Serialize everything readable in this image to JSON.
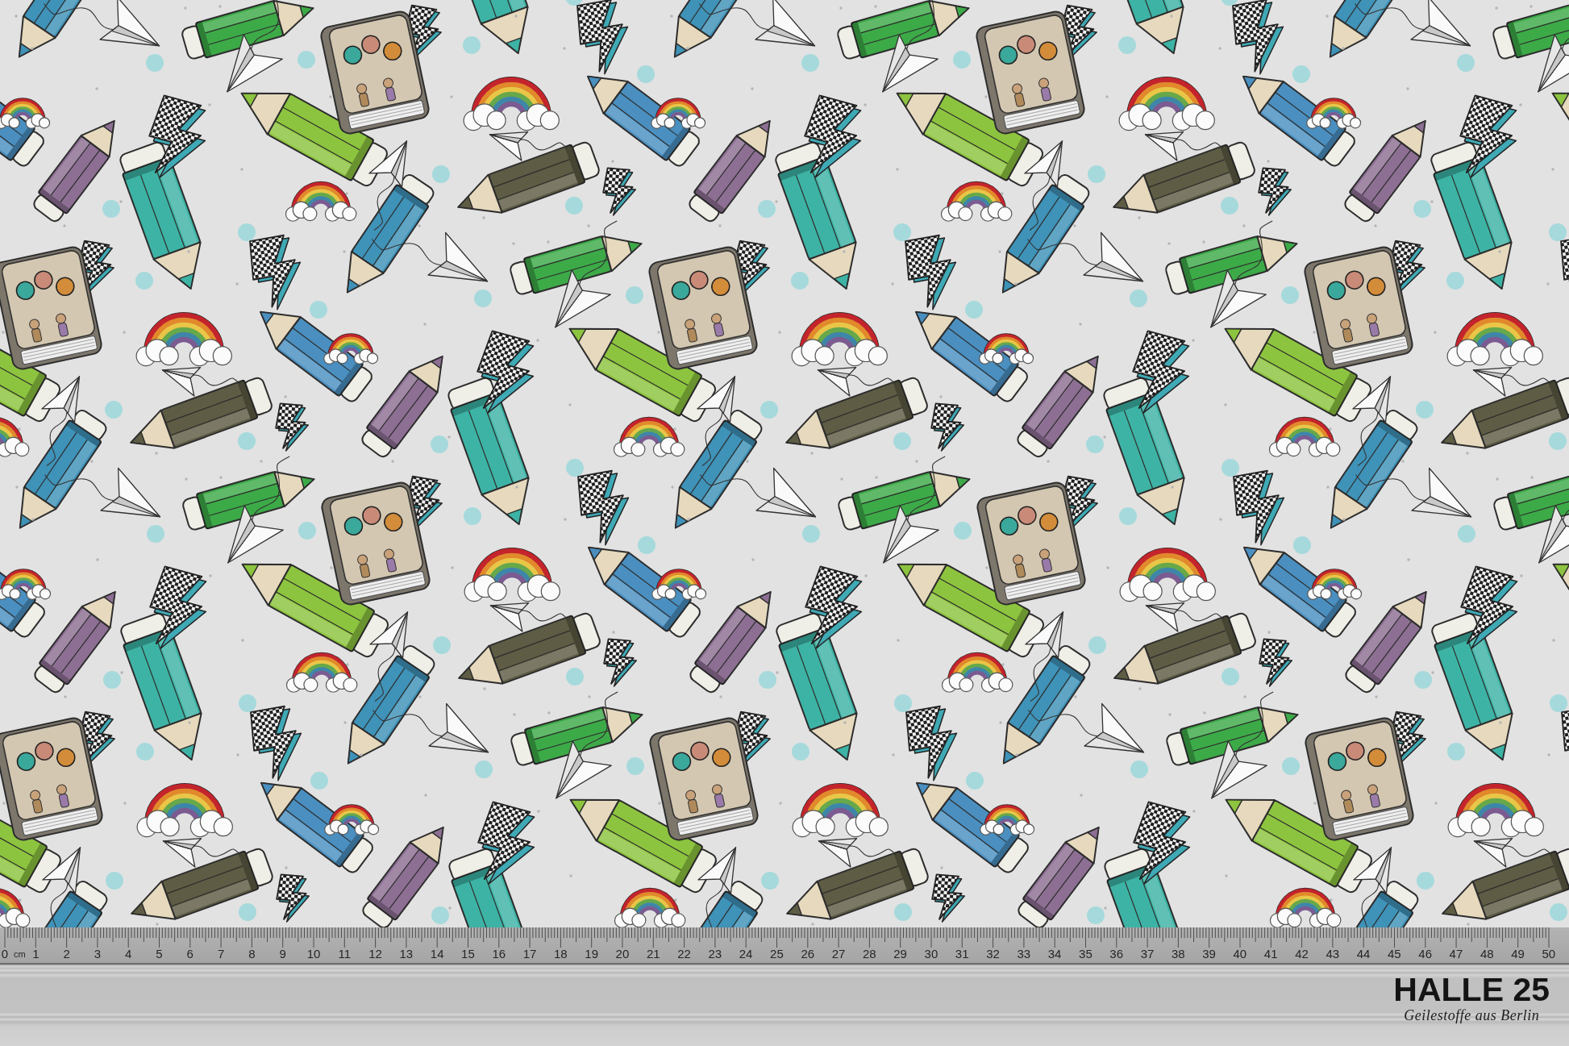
{
  "ruler": {
    "unit": "cm",
    "labels": [
      "0",
      "1",
      "2",
      "3",
      "4",
      "5",
      "6",
      "7",
      "8",
      "9",
      "10",
      "11",
      "12",
      "13",
      "14",
      "15",
      "16",
      "17",
      "18",
      "19",
      "20",
      "21",
      "22",
      "23",
      "24",
      "25",
      "26",
      "27",
      "28",
      "29",
      "30",
      "31",
      "32",
      "33",
      "34",
      "35",
      "36",
      "37",
      "38",
      "39",
      "40",
      "41",
      "42",
      "43",
      "44",
      "45",
      "46",
      "47",
      "48",
      "49",
      "50"
    ]
  },
  "brand": {
    "name": "HALLE 25",
    "tagline": "Geilestoffe aus Berlin"
  }
}
